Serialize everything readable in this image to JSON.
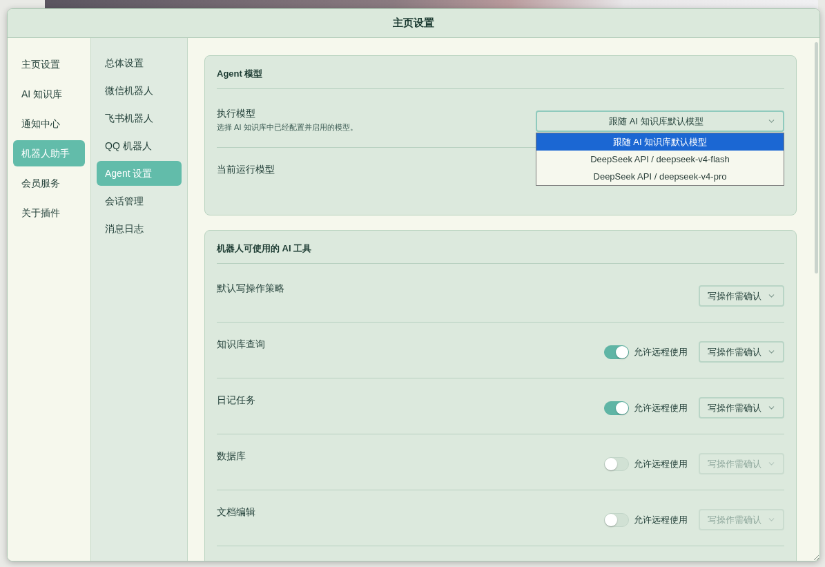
{
  "dialog": {
    "title": "主页设置"
  },
  "nav": [
    {
      "label": "主页设置",
      "selected": false
    },
    {
      "label": "AI 知识库",
      "selected": false
    },
    {
      "label": "通知中心",
      "selected": false
    },
    {
      "label": "机器人助手",
      "selected": true
    },
    {
      "label": "会员服务",
      "selected": false
    },
    {
      "label": "关于插件",
      "selected": false
    }
  ],
  "subnav": [
    {
      "label": "总体设置",
      "selected": false
    },
    {
      "label": "微信机器人",
      "selected": false
    },
    {
      "label": "飞书机器人",
      "selected": false
    },
    {
      "label": "QQ 机器人",
      "selected": false
    },
    {
      "label": "Agent 设置",
      "selected": true
    },
    {
      "label": "会话管理",
      "selected": false
    },
    {
      "label": "消息日志",
      "selected": false
    }
  ],
  "sections": [
    {
      "title": "Agent 模型",
      "rows": [
        {
          "kind": "model",
          "label": "执行模型",
          "description": "选择 AI 知识库中已经配置并启用的模型。",
          "value": "跟随 AI 知识库默认模型",
          "open": true,
          "options": [
            {
              "label": "跟随 AI 知识库默认模型",
              "selected": true
            },
            {
              "label": "DeepSeek API / deepseek-v4-flash",
              "selected": false
            },
            {
              "label": "DeepSeek API / deepseek-v4-pro",
              "selected": false
            }
          ]
        },
        {
          "kind": "info",
          "label": "当前运行模型"
        }
      ]
    },
    {
      "title": "机器人可使用的 AI 工具",
      "rows": [
        {
          "kind": "policy",
          "label": "默认写操作策略",
          "select": {
            "value": "写操作需确认",
            "disabled": false
          }
        },
        {
          "kind": "tool",
          "label": "知识库查询",
          "remote": {
            "label": "允许远程使用",
            "on": true
          },
          "select": {
            "value": "写操作需确认",
            "disabled": false
          }
        },
        {
          "kind": "tool",
          "label": "日记任务",
          "remote": {
            "label": "允许远程使用",
            "on": true
          },
          "select": {
            "value": "写操作需确认",
            "disabled": false
          }
        },
        {
          "kind": "tool",
          "label": "数据库",
          "remote": {
            "label": "允许远程使用",
            "on": false
          },
          "select": {
            "value": "写操作需确认",
            "disabled": true
          }
        },
        {
          "kind": "tool",
          "label": "文档编辑",
          "remote": {
            "label": "允许远程使用",
            "on": false
          },
          "select": {
            "value": "写操作需确认",
            "disabled": true
          }
        }
      ]
    }
  ]
}
